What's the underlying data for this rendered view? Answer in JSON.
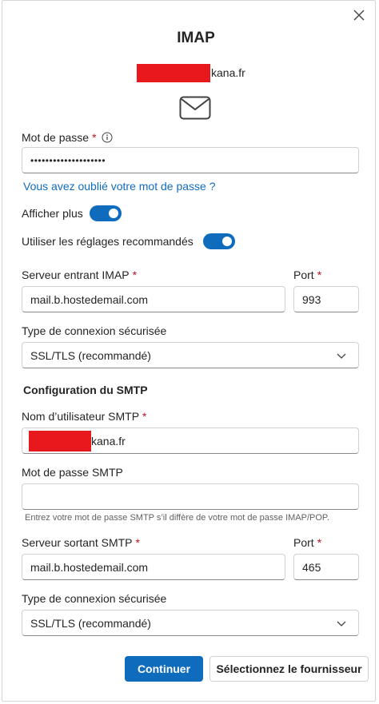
{
  "dialog": {
    "title": "IMAP",
    "email_suffix": "kana.fr",
    "close_icon": "close-icon",
    "mail_icon": "envelope-icon"
  },
  "password": {
    "label": "Mot de passe",
    "required_mark": "*",
    "value": "••••••••••••••••••••",
    "forgot_link": "Vous avez oublié votre mot de passe ?"
  },
  "toggles": {
    "show_more_label": "Afficher plus",
    "show_more_on": true,
    "recommended_label": "Utiliser les réglages recommandés",
    "recommended_on": true
  },
  "incoming": {
    "server_label": "Serveur entrant IMAP",
    "required_mark": "*",
    "server_value": "mail.b.hostedemail.com",
    "port_label": "Port",
    "port_value": "993",
    "security_label": "Type de connexion sécurisée",
    "security_value": "SSL/TLS (recommandé)"
  },
  "smtp": {
    "section_title": "Configuration du SMTP",
    "username_label": "Nom d’utilisateur SMTP",
    "required_mark": "*",
    "username_suffix": "kana.fr",
    "password_label": "Mot de passe SMTP",
    "password_value": "",
    "password_hint": "Entrez votre mot de passe SMTP s’il diffère de votre mot de passe IMAP/POP.",
    "server_label": "Serveur sortant SMTP",
    "server_value": "mail.b.hostedemail.com",
    "port_label": "Port",
    "port_value": "465",
    "security_label": "Type de connexion sécurisée",
    "security_value": "SSL/TLS (recommandé)"
  },
  "actions": {
    "continue_label": "Continuer",
    "select_provider_label": "Sélectionnez le fournisseur"
  },
  "colors": {
    "accent": "#0f6cbd",
    "required": "#c50f1f",
    "redaction": "#e8191c"
  }
}
